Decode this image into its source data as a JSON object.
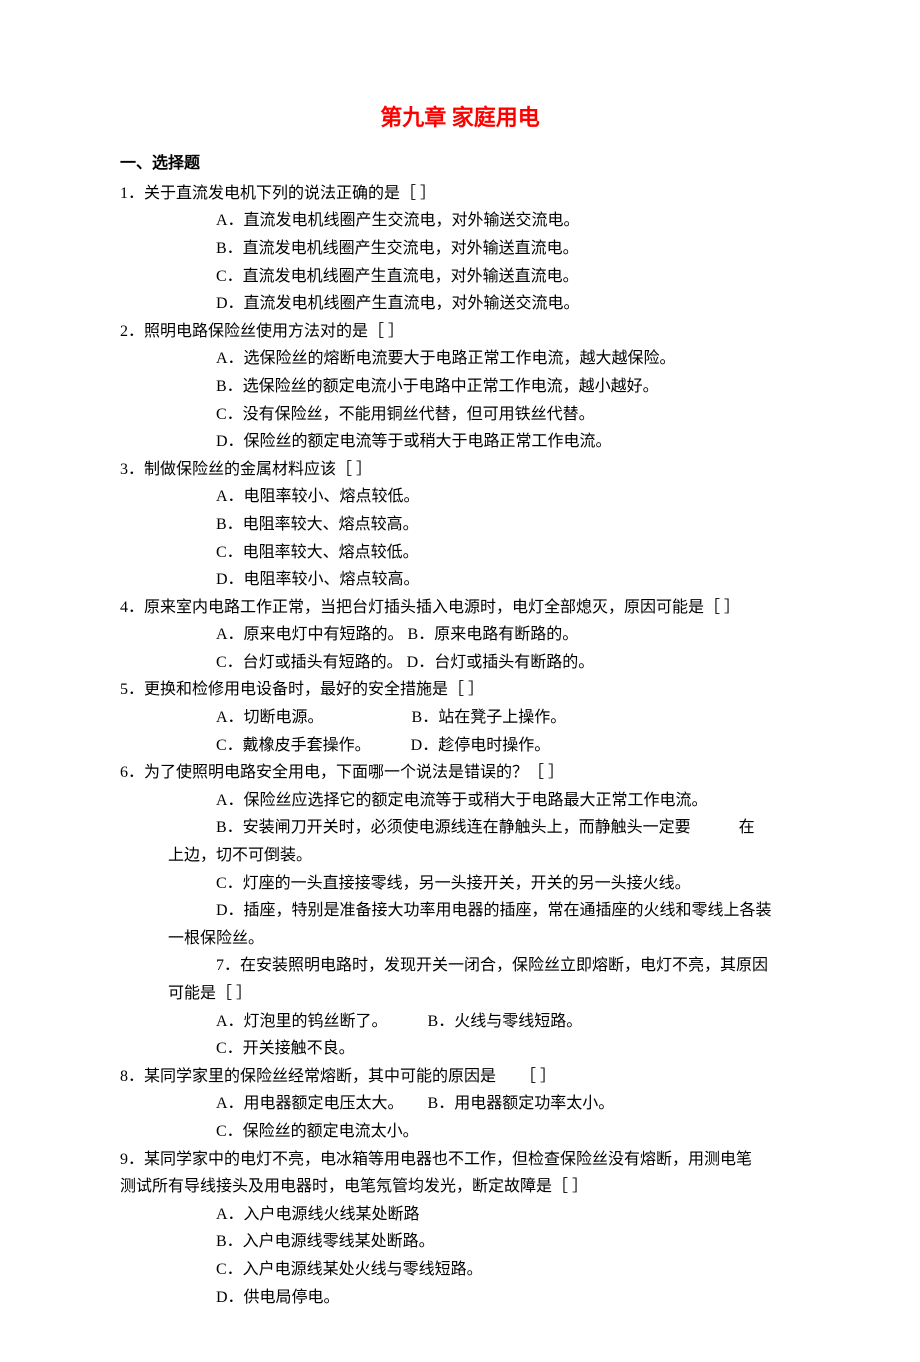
{
  "title": "第九章  家庭用电",
  "section_header": "一、选择题",
  "q1": {
    "stem": "1．关于直流发电机下列的说法正确的是［ ］",
    "A": "A．直流发电机线圈产生交流电，对外输送交流电。",
    "B": "B．直流发电机线圈产生交流电，对外输送直流电。",
    "C": "C．直流发电机线圈产生直流电，对外输送直流电。",
    "D": "D．直流发电机线圈产生直流电，对外输送交流电。"
  },
  "q2": {
    "stem": "2．照明电路保险丝使用方法对的是［ ］",
    "A": "A．选保险丝的熔断电流要大于电路正常工作电流，越大越保险。",
    "B": "B．选保险丝的额定电流小于电路中正常工作电流，越小越好。",
    "C": "C．没有保险丝，不能用铜丝代替，但可用铁丝代替。",
    "D": "D．保险丝的额定电流等于或稍大于电路正常工作电流。"
  },
  "q3": {
    "stem": "3．制做保险丝的金属材料应该［ ］",
    "A": "A．电阻率较小、熔点较低。",
    "B": "B．电阻率较大、熔点较高。",
    "C": "C．电阻率较大、熔点较低。",
    "D": "D．电阻率较小、熔点较高。"
  },
  "q4": {
    "stem": "4．原来室内电路工作正常，当把台灯插头插入电源时，电灯全部熄灭，原因可能是［ ］",
    "lineAB": "A．原来电灯中有短路的。  B．原来电路有断路的。",
    "lineCD": "C．台灯或插头有短路的。  D．台灯或插头有断路的。"
  },
  "q5": {
    "stem": "5．更换和检修用电设备时，最好的安全措施是［ ］",
    "lineAB": "A．切断电源。　　　　　　B．站在凳子上操作。",
    "lineCD": "C．戴橡皮手套操作。　　　D．趁停电时操作。"
  },
  "q6": {
    "stem": "6．为了使照明电路安全用电，下面哪一个说法是错误的？［ ］",
    "A": "A．保险丝应选择它的额定电流等于或稍大于电路最大正常工作电流。",
    "B_part1": "B．安装闸刀开关时，必须使电源线连在静触头上，而静触头一定要　　　在",
    "B_part2": "上边，切不可倒装。",
    "C": "C．灯座的一头直接接零线，另一头接开关，开关的另一头接火线。",
    "D_part1": "D．插座，特别是准备接大功率用电器的插座，常在通插座的火线和零线上各装",
    "D_part2": "一根保险丝。"
  },
  "q7": {
    "stem": "7．在安装照明电路时，发现开关一闭合，保险丝立即熔断，电灯不亮，其原因",
    "stem2": "可能是［ ］",
    "lineAB": "A．灯泡里的钨丝断了。　　　B．火线与零线短路。",
    "C": "C．开关接触不良。"
  },
  "q8": {
    "stem": "8．某同学家里的保险丝经常熔断，其中可能的原因是　　［ ］",
    "lineAB": "A．用电器额定电压太大。　　B．用电器额定功率太小。",
    "C": "C．保险丝的额定电流太小。"
  },
  "q9": {
    "stem1": "9．某同学家中的电灯不亮，电冰箱等用电器也不工作，但检查保险丝没有熔断，用测电笔",
    "stem2": "测试所有导线接头及用电器时，电笔氖管均发光，断定故障是［ ］",
    "A": "A．入户电源线火线某处断路",
    "B": "B．入户电源线零线某处断路。",
    "C": "C．入户电源线某处火线与零线短路。",
    "D": "D．供电局停电。"
  }
}
